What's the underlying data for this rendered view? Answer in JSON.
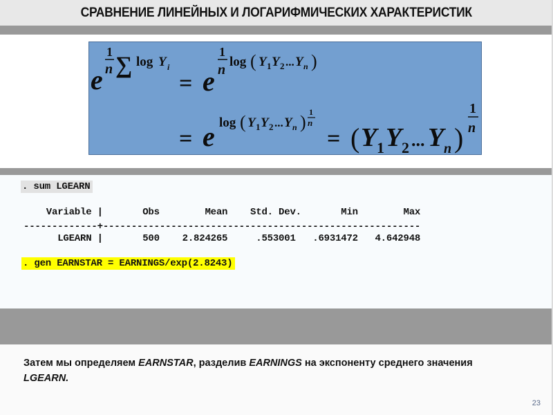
{
  "slide": {
    "title": "СРАВНЕНИЕ ЛИНЕЙНЫХ И ЛОГАРИФМИЧЕСКИХ ХАРАКТЕРИСТИК",
    "page_number": "23",
    "colors": {
      "title_band": "#e8e8e8",
      "separator_bars": "#999999",
      "formula_box": "#739fd0",
      "code_panel": "#f8fbfd",
      "highlight_gray": "#e2e2e2",
      "highlight_yellow": "#ffff00",
      "page_number": "#5a6a8a"
    }
  },
  "formula": {
    "line1_lhs": "e^((1/n) Σ log Y_i)",
    "line1_rhs": "= e^((1/n) log(Y_1 Y_2 ... Y_n))",
    "line2_mid": "= e^(log(Y_1 Y_2 ... Y_n)^(1/n))",
    "line2_rhs": "= (Y_1 Y_2 ... Y_n)^(1/n)",
    "parts": {
      "e": "e",
      "one": "1",
      "n": "n",
      "sigma": "∑",
      "log": "log",
      "Y": "Y",
      "i": "i",
      "sub1": "1",
      "sub2": "2",
      "dots": "...",
      "eq": "=",
      "lparen": "(",
      "rparen": ")"
    }
  },
  "stata": {
    "command1": ". sum LGEARN",
    "table": {
      "columns": [
        "Variable",
        "Obs",
        "Mean",
        "Std. Dev.",
        "Min",
        "Max"
      ],
      "header_line": "    Variable |       Obs        Mean    Std. Dev.       Min        Max",
      "separator_line": "-------------+--------------------------------------------------------",
      "rows": [
        {
          "variable": "LGEARN",
          "obs": "500",
          "mean": "2.824265",
          "std_dev": ".553001",
          "min": ".6931472",
          "max": "4.642948",
          "line": "      LGEARN |       500    2.824265     .553001   .6931472   4.642948"
        }
      ]
    },
    "command2": ". gen EARNSTAR = EARNINGS/exp(2.8243)"
  },
  "caption": {
    "t1": "Затем мы определяем ",
    "v1": "EARNSTAR",
    "t2": ", разделив ",
    "v2": "EARNINGS",
    "t3": " на экспоненту среднего значения ",
    "v3": "LGEARN.",
    "t4": ""
  }
}
